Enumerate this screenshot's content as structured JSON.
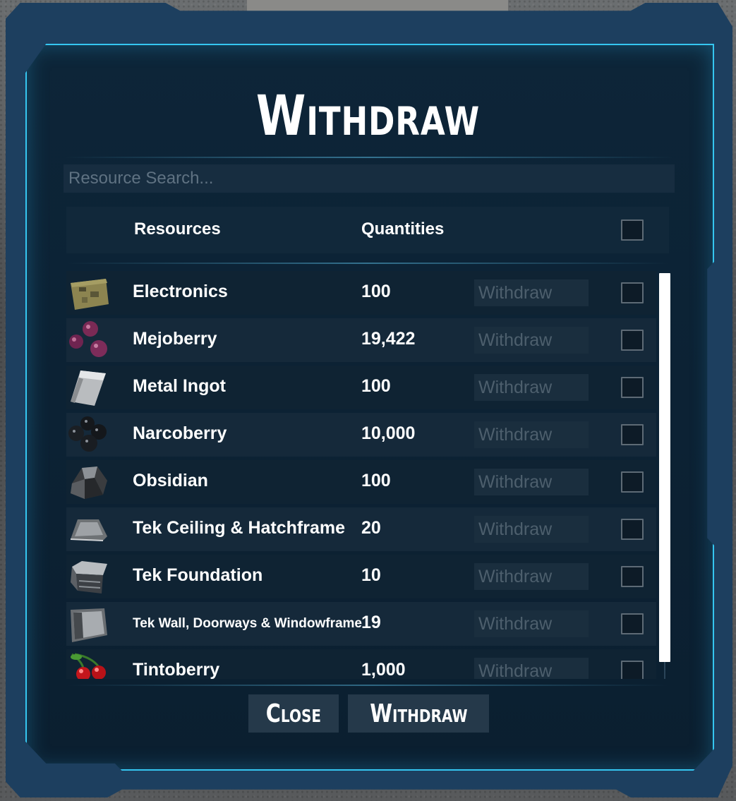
{
  "title": "Withdraw",
  "search": {
    "placeholder": "Resource Search..."
  },
  "header": {
    "resources_label": "Resources",
    "quantities_label": "Quantities"
  },
  "rows": [
    {
      "name": "Electronics",
      "quantity": "100",
      "withdraw_placeholder": "Withdraw",
      "icon": "electronics-icon"
    },
    {
      "name": "Mejoberry",
      "quantity": "19,422",
      "withdraw_placeholder": "Withdraw",
      "icon": "mejoberry-icon"
    },
    {
      "name": "Metal Ingot",
      "quantity": "100",
      "withdraw_placeholder": "Withdraw",
      "icon": "metal-ingot-icon"
    },
    {
      "name": "Narcoberry",
      "quantity": "10,000",
      "withdraw_placeholder": "Withdraw",
      "icon": "narcoberry-icon"
    },
    {
      "name": "Obsidian",
      "quantity": "100",
      "withdraw_placeholder": "Withdraw",
      "icon": "obsidian-icon"
    },
    {
      "name": "Tek Ceiling & Hatchframe",
      "quantity": "20",
      "withdraw_placeholder": "Withdraw",
      "icon": "tek-ceiling-icon"
    },
    {
      "name": "Tek Foundation",
      "quantity": "10",
      "withdraw_placeholder": "Withdraw",
      "icon": "tek-foundation-icon"
    },
    {
      "name": "Tek Wall, Doorways & Windowframe",
      "quantity": "19",
      "withdraw_placeholder": "Withdraw",
      "icon": "tek-wall-icon"
    },
    {
      "name": "Tintoberry",
      "quantity": "1,000",
      "withdraw_placeholder": "Withdraw",
      "icon": "tintoberry-icon"
    }
  ],
  "buttons": {
    "close_label": "Close",
    "withdraw_label": "Withdraw"
  },
  "colors": {
    "frame_accent": "#35c6f0",
    "panel_bg": "#0b1f30",
    "text": "#ffffff",
    "placeholder": "#4d5f6d"
  }
}
